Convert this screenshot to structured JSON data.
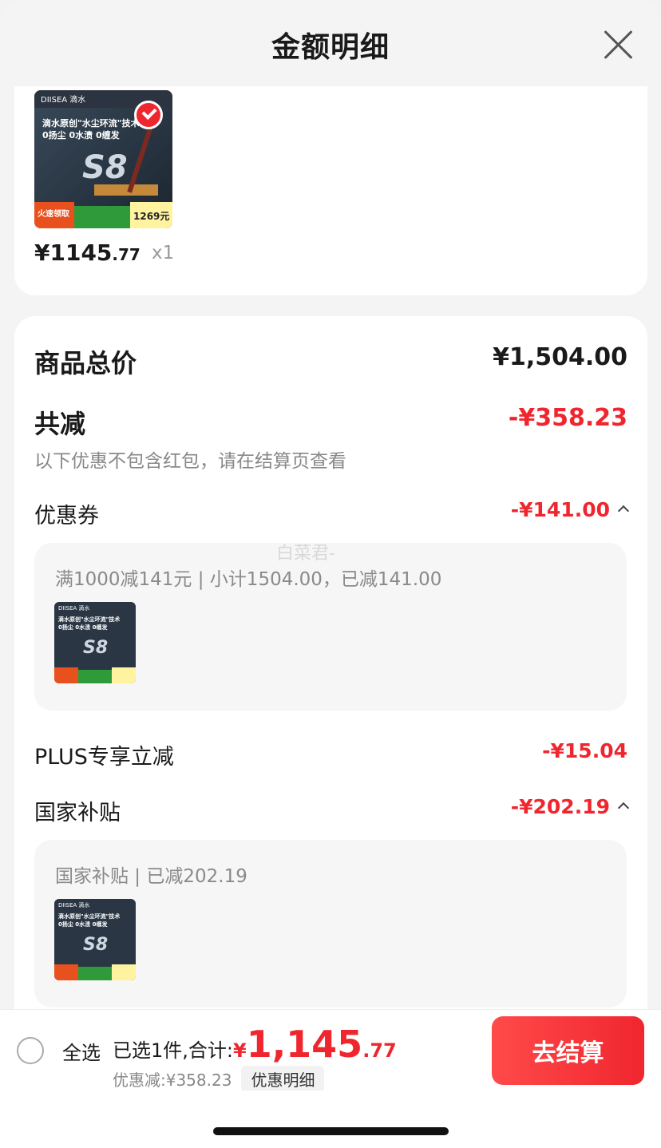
{
  "header": {
    "title": "金额明细"
  },
  "product": {
    "price_int": "¥1145",
    "price_dec": ".77",
    "qty": "x1",
    "image_label": "S8"
  },
  "summary": {
    "total_label": "商品总价",
    "total_value": "¥1,504.00",
    "discount_label": "共减",
    "discount_value": "-¥358.23",
    "discount_note": "以下优惠不包含红包，请在结算页查看"
  },
  "coupon": {
    "label": "优惠券",
    "value": "-¥141.00",
    "detail": "满1000减141元 | 小计1504.00，已减141.00"
  },
  "plus": {
    "label": "PLUS专享立减",
    "value": "-¥15.04"
  },
  "subsidy": {
    "label": "国家补贴",
    "value": "-¥202.19",
    "detail": "国家补贴 | 已减202.19"
  },
  "watermark": "白菜君-",
  "bottom": {
    "select_all": "全选",
    "selected_label": "已选1件,合计:",
    "currency": "¥",
    "total_int": "1,145",
    "total_dec": ".77",
    "discount_text": "优惠减:¥358.23",
    "discount_btn": "优惠明细",
    "checkout": "去结算"
  },
  "colors": {
    "accent": "#f0262f",
    "background": "#f4f4f4"
  }
}
